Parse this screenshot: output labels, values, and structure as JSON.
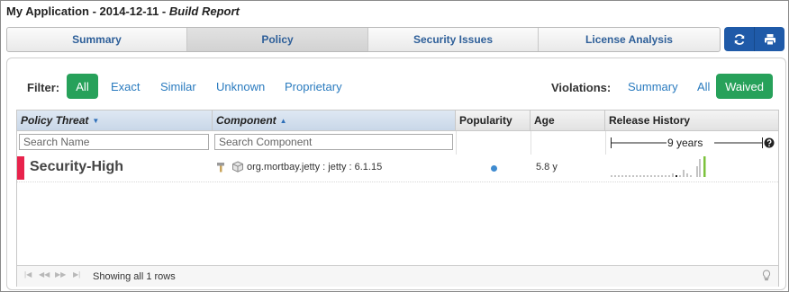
{
  "app": {
    "title_prefix": "My Application - 2014-12-11 - ",
    "title_suffix": "Build Report"
  },
  "tabs": [
    {
      "label": "Summary",
      "active": false
    },
    {
      "label": "Policy",
      "active": true
    },
    {
      "label": "Security Issues",
      "active": false
    },
    {
      "label": "License Analysis",
      "active": false
    }
  ],
  "toolbar": {
    "refresh_icon": "refresh-icon",
    "print_icon": "print-icon"
  },
  "filter": {
    "label": "Filter:",
    "options": [
      "All",
      "Exact",
      "Similar",
      "Unknown",
      "Proprietary"
    ],
    "selected": "All"
  },
  "violations": {
    "label": "Violations:",
    "options": [
      "Summary",
      "All",
      "Waived"
    ],
    "selected": "Waived"
  },
  "columns": {
    "policy_threat": "Policy Threat",
    "component": "Component",
    "popularity": "Popularity",
    "age": "Age",
    "release_history": "Release History"
  },
  "search": {
    "name_placeholder": "Search Name",
    "component_placeholder": "Search Component",
    "history_span": "9 years",
    "help_icon": "help-icon"
  },
  "rows": [
    {
      "threat": "Security-High",
      "threat_color": "#e8234c",
      "component": "org.mortbay.jetty : jetty : 6.1.15",
      "popularity": 0.5,
      "age": "5.8 y"
    }
  ],
  "pager": {
    "showing": "Showing all 1 rows"
  },
  "colors": {
    "brand_blue": "#1f5aa8",
    "green": "#27a15a",
    "link": "#2a7bbf",
    "current_release": "#7cc23c"
  }
}
